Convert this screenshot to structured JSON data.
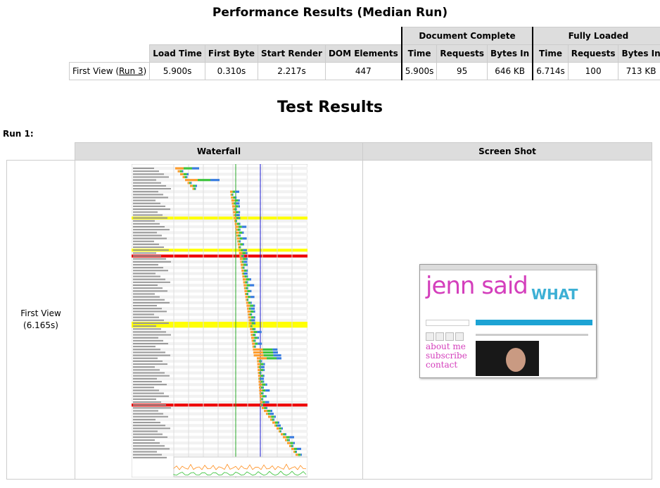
{
  "perf_title": "Performance Results (Median Run)",
  "test_title": "Test Results",
  "perf": {
    "groups": {
      "doc_complete": "Document Complete",
      "fully_loaded": "Fully Loaded"
    },
    "headers": [
      "Load Time",
      "First Byte",
      "Start Render",
      "DOM Elements",
      "Time",
      "Requests",
      "Bytes In",
      "Time",
      "Requests",
      "Bytes In"
    ],
    "row_label": "First View (",
    "run_link": "Run 3",
    "row_label_end": ")",
    "values": [
      "5.900s",
      "0.310s",
      "2.217s",
      "447",
      "5.900s",
      "95",
      "646 KB",
      "6.714s",
      "100",
      "713 KB"
    ]
  },
  "run_label": "Run 1:",
  "results": {
    "col_waterfall": "Waterfall",
    "col_screenshot": "Screen Shot",
    "view_label": "First View",
    "view_time": "(6.165s)"
  },
  "screenshot": {
    "page_title": "jenn said",
    "page_title_2": "WHAT",
    "links": [
      "about me",
      "subscribe",
      "contact"
    ]
  },
  "colors": {
    "header_bg": "#dddddd",
    "accent_pink": "#d43fbc",
    "accent_blue": "#1da3d4"
  }
}
